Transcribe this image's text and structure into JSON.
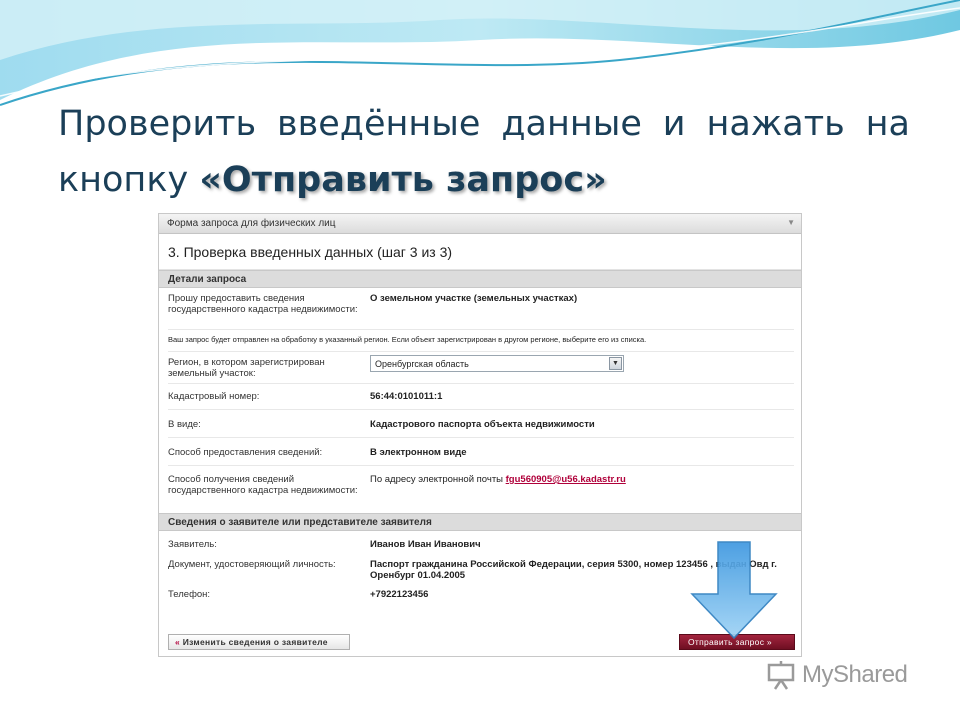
{
  "slide": {
    "title_part1": "Проверить введённые данные и нажать на кнопку ",
    "title_accent": "«Отправить запрос»"
  },
  "form": {
    "header": "Форма запроса для физических лиц",
    "step_title_main": "3. Проверка введенных данных",
    "step_title_suffix": " (шаг 3 из 3)",
    "details_section": "Детали запроса",
    "applicant_section": "Сведения о заявителе или представителе заявителя",
    "note": "Ваш запрос будет отправлен на обработку в указанный регион. Если объект зарегистрирован в другом регионе, выберите его из списка.",
    "rows": [
      {
        "label": "Прошу предоставить сведения государственного кадастра недвижимости:",
        "value": "О земельном участке (земельных участках)"
      },
      {
        "label": "Регион, в котором зарегистрирован земельный участок:",
        "value": "Оренбургская область"
      },
      {
        "label": "Кадастровый номер:",
        "value": "56:44:0101011:1"
      },
      {
        "label": "В виде:",
        "value": "Кадастрового паспорта объекта недвижимости"
      },
      {
        "label": "Способ предоставления сведений:",
        "value": "В электронном виде"
      },
      {
        "label": "Способ получения сведений государственного кадастра недвижимости:",
        "value_prefix": "По адресу электронной почты ",
        "value": "fgu560905@u56.kadastr.ru"
      }
    ],
    "applicant_rows": [
      {
        "label": "Заявитель:",
        "value": "Иванов Иван Иванович"
      },
      {
        "label": "Документ, удостоверяющий личность:",
        "value": "Паспорт гражданина Российской Федерации, серия 5300, номер 123456 , выдан Овд г. Оренбург 01.04.2005"
      },
      {
        "label": "Телефон:",
        "value": "+7922123456"
      }
    ],
    "back_button": "Изменить сведения о заявителе",
    "back_chevron": "«",
    "submit_button": "Отправить запрос »"
  },
  "watermark": {
    "text": "MyShared"
  },
  "colors": {
    "title": "#1b3f58",
    "link": "#b0003a",
    "submit": "#8b1a30",
    "arrow": "#3fa0e0"
  }
}
